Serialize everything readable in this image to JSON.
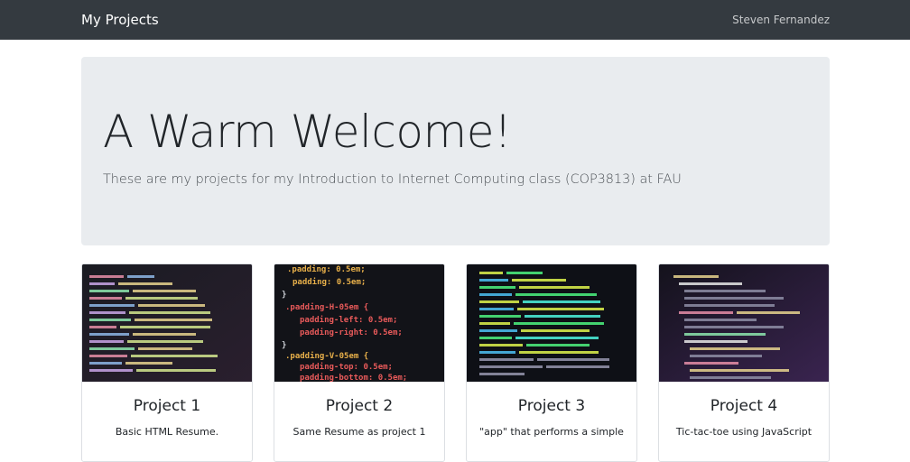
{
  "nav": {
    "brand": "My Projects",
    "user": "Steven Fernandez",
    "bg_color": "#343a40"
  },
  "jumbotron": {
    "title": "A Warm Welcome!",
    "lead": "These are my projects for my Introduction to Internet Computing class (COP3813) at FAU"
  },
  "cards": [
    {
      "title": "Project 1",
      "text": "Basic HTML Resume.",
      "image": "code-screenshot-image"
    },
    {
      "title": "Project 2",
      "text": "Same Resume as project 1",
      "image": "code-screenshot-image"
    },
    {
      "title": "Project 3",
      "text": "\"app\" that performs a simple",
      "image": "code-screenshot-image"
    },
    {
      "title": "Project 4",
      "text": "Tic-tac-toe using JavaScript",
      "image": "code-screenshot-image"
    }
  ]
}
